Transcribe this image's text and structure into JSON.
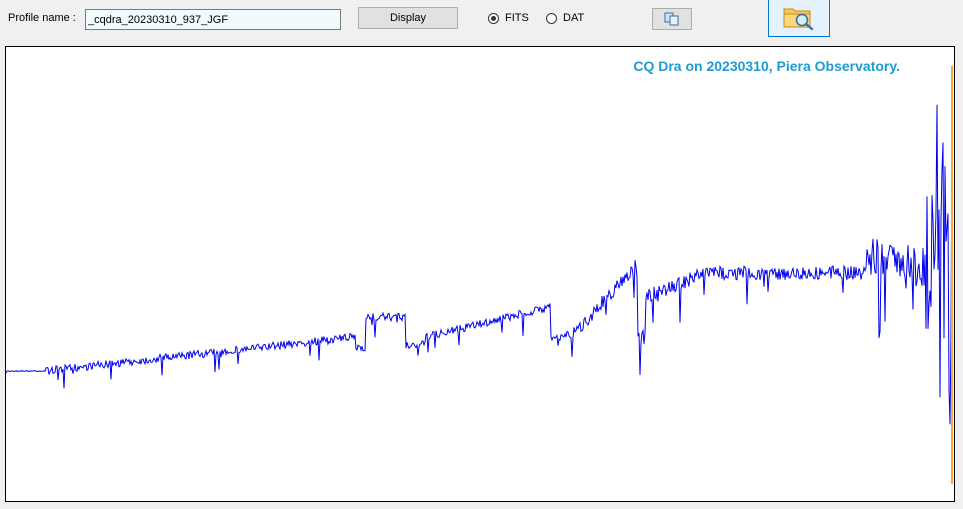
{
  "toolbar": {
    "profile_label": "Profile name :",
    "profile_value": "_cqdra_20230310_937_JGF",
    "display_label": "Display",
    "radio_fits_label": "FITS",
    "radio_dat_label": "DAT",
    "selected_format": "FITS",
    "copy_icon": "copy-icon",
    "open_icon": "folder-search-icon"
  },
  "plot": {
    "title": "CQ Dra on 20230310, Piera Observatory.",
    "title_color": "#1a9cd6",
    "line_color": "#0000ee"
  }
}
